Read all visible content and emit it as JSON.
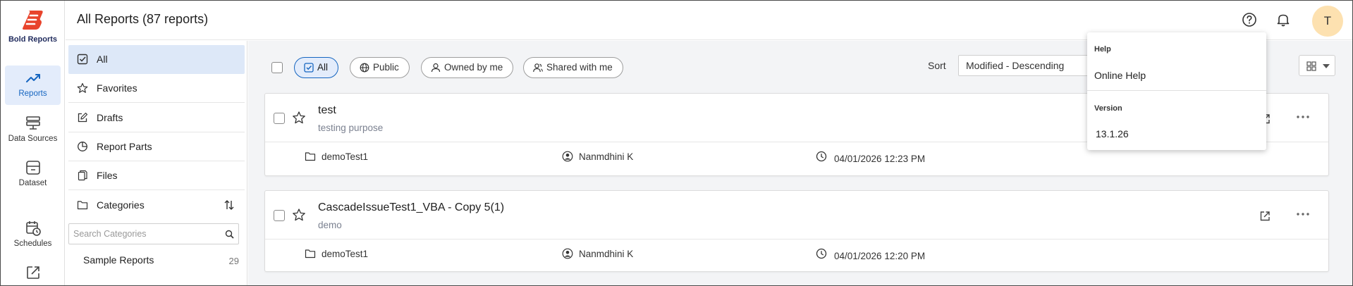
{
  "app": {
    "brand": "Bold Reports",
    "brand_color": "#e8442c",
    "accent_color": "#1565c0"
  },
  "rail": [
    {
      "label": "Reports",
      "icon": "reports-trend-icon",
      "active": true
    },
    {
      "label": "Data Sources",
      "icon": "data-sources-icon",
      "active": false
    },
    {
      "label": "Dataset",
      "icon": "dataset-icon",
      "active": false
    },
    {
      "label": "Schedules",
      "icon": "schedules-icon",
      "active": false
    },
    {
      "label": "",
      "icon": "export-icon",
      "active": false
    }
  ],
  "header": {
    "title": "All Reports (87 reports)",
    "user_initial": "T"
  },
  "sidebar": {
    "items": [
      {
        "label": "All",
        "icon": "checkbox-icon",
        "active": true
      },
      {
        "label": "Favorites",
        "icon": "star-icon"
      },
      {
        "label": "Drafts",
        "icon": "edit-icon"
      },
      {
        "label": "Report Parts",
        "icon": "pie-chart-icon"
      },
      {
        "label": "Files",
        "icon": "files-icon"
      },
      {
        "label": "Categories",
        "icon": "folder-icon"
      }
    ],
    "category_search_placeholder": "Search Categories",
    "categories": [
      {
        "name": "Sample Reports",
        "count": "29"
      }
    ]
  },
  "filters": {
    "chips": [
      {
        "label": "All",
        "icon": "checkbox-icon",
        "active": true
      },
      {
        "label": "Public",
        "icon": "globe-icon"
      },
      {
        "label": "Owned by me",
        "icon": "user-icon"
      },
      {
        "label": "Shared with me",
        "icon": "users-icon"
      }
    ],
    "sort_label": "Sort",
    "sort_value": "Modified - Descending"
  },
  "reports": [
    {
      "title": "test",
      "description": "testing purpose",
      "category": "demoTest1",
      "owner": "Nanmdhini K",
      "modified": "04/01/2026 12:23 PM"
    },
    {
      "title": "CascadeIssueTest1_VBA - Copy 5(1)",
      "description": "demo",
      "category": "demoTest1",
      "owner": "Nanmdhini K",
      "modified": "04/01/2026 12:20 PM"
    }
  ],
  "help_popup": {
    "help_heading": "Help",
    "online_help": "Online Help",
    "version_heading": "Version",
    "version": "13.1.26"
  }
}
